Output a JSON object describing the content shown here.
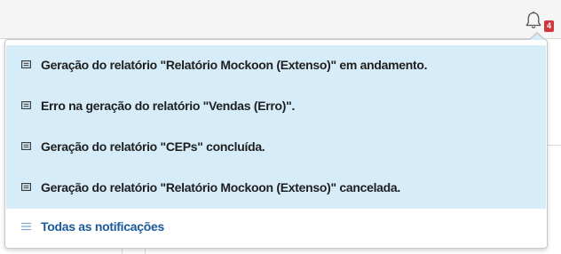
{
  "header": {
    "notification_count": "4",
    "bell_icon": "bell-icon",
    "badge_color": "#d0363a"
  },
  "notifications": {
    "items": [
      {
        "icon": "message-icon",
        "text": "Geração do relatório \"Relatório Mockoon (Extenso)\" em andamento."
      },
      {
        "icon": "message-icon",
        "text": "Erro na geração do relatório \"Vendas (Erro)\"."
      },
      {
        "icon": "message-icon",
        "text": "Geração do relatório \"CEPs\" concluída."
      },
      {
        "icon": "message-icon",
        "text": "Geração do relatório \"Relatório Mockoon (Extenso)\" cancelada."
      }
    ],
    "highlight_color": "#d6ecf8",
    "footer": {
      "icon": "list-icon",
      "label": "Todas as notificações",
      "color": "#1a5a9a"
    }
  }
}
